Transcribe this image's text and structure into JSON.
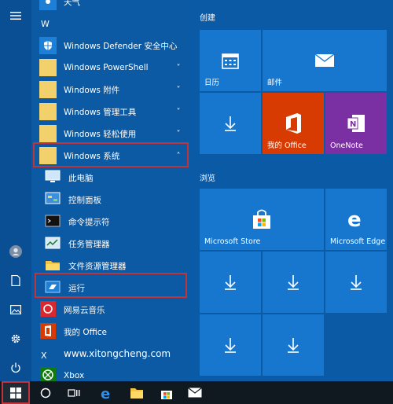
{
  "apps": {
    "top_partial": "天气",
    "letter_w": "W",
    "items": [
      {
        "label": "Windows Defender 安全中心",
        "chevron": ""
      },
      {
        "label": "Windows PowerShell",
        "chevron": "˅"
      },
      {
        "label": "Windows 附件",
        "chevron": "˅"
      },
      {
        "label": "Windows 管理工具",
        "chevron": "˅"
      },
      {
        "label": "Windows 轻松使用",
        "chevron": "˅"
      },
      {
        "label": "Windows 系统",
        "chevron": "˄"
      }
    ],
    "sub_items": [
      {
        "label": "此电脑"
      },
      {
        "label": "控制面板"
      },
      {
        "label": "命令提示符"
      },
      {
        "label": "任务管理器"
      },
      {
        "label": "文件资源管理器"
      },
      {
        "label": "运行"
      }
    ],
    "after_items": [
      {
        "label": "网易云音乐"
      },
      {
        "label": "我的 Office"
      }
    ],
    "website": "www.xitongcheng.com",
    "letter_x": "X",
    "xbox": "Xbox"
  },
  "tiles": {
    "group1": "创建",
    "group2": "浏览",
    "calendar": "日历",
    "mail": "邮件",
    "office": "我的 Office",
    "onenote": "OneNote",
    "store": "Microsoft Store",
    "edge": "Microsoft Edge"
  },
  "colors": {
    "tile_blue": "#1777cf",
    "office_orange": "#d83b01",
    "onenote_purple": "#7a2fa3",
    "highlight_red": "#c0343b"
  }
}
